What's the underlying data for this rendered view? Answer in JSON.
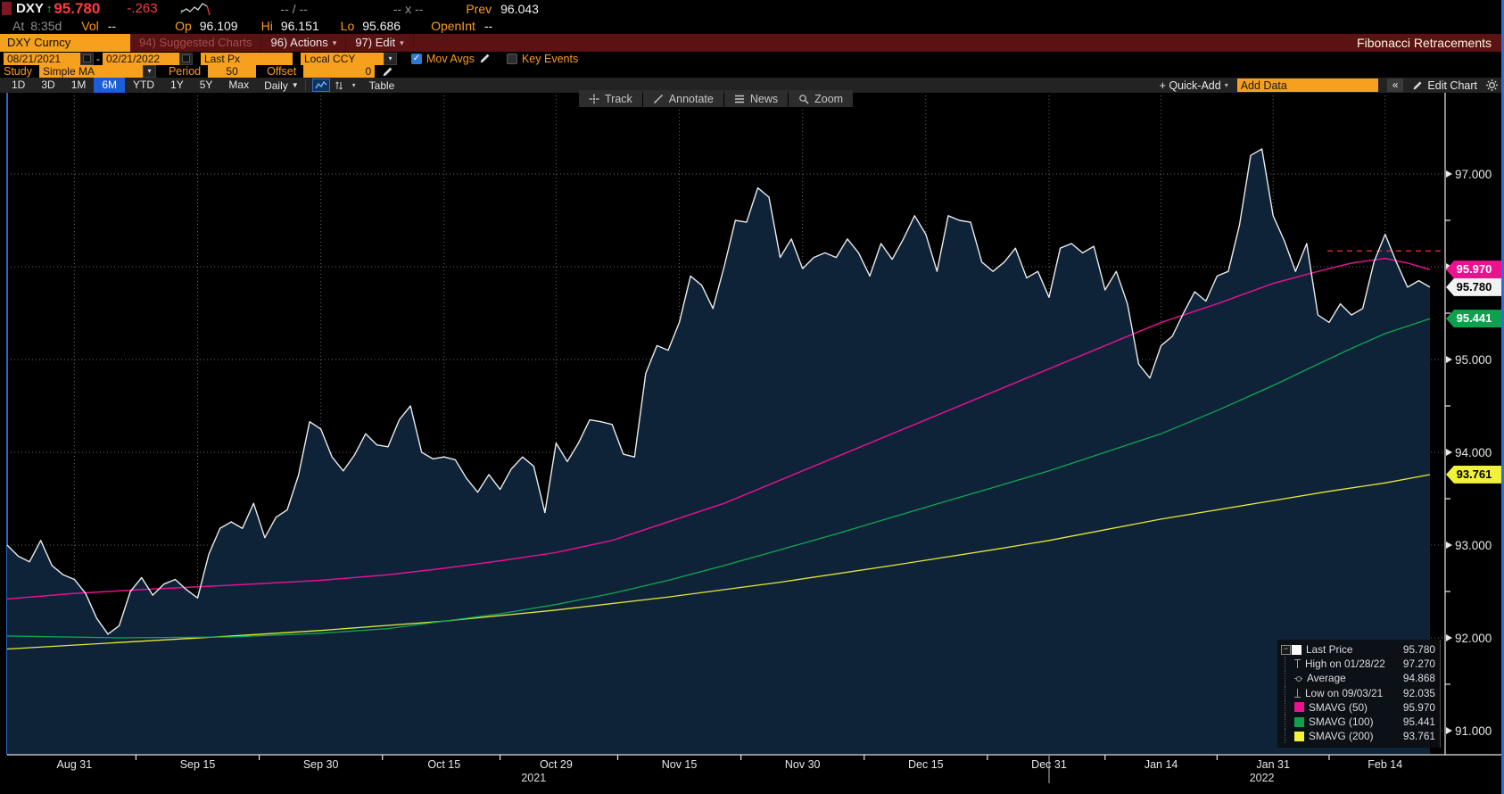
{
  "quote": {
    "symbol": "DXY",
    "direction_arrow": "↑",
    "price": "95.780",
    "change": "-.263",
    "bid_ask": "-- / --",
    "cross": "-- x --",
    "prev_label": "Prev",
    "prev_value": "96.043",
    "at_label": "At",
    "at_value": "8:35d",
    "vol_label": "Vol",
    "vol_value": "--",
    "op_label": "Op",
    "op_value": "96.109",
    "hi_label": "Hi",
    "hi_value": "96.151",
    "lo_label": "Lo",
    "lo_value": "95.686",
    "openint_label": "OpenInt",
    "openint_value": "--"
  },
  "security_bar": {
    "ticker": "DXY Curncy",
    "suggested_charts": "94) Suggested Charts",
    "actions": "96) Actions",
    "edit": "97) Edit",
    "title": "Fibonacci Retracements"
  },
  "settings_bar": {
    "date_from": "08/21/2021",
    "separator": "-",
    "date_to": "02/21/2022",
    "price_field": "Last Px",
    "currency": "Local CCY",
    "mov_avgs": "Mov Avgs",
    "mov_avgs_checked": "✓",
    "key_events": "Key Events"
  },
  "study_bar": {
    "study_label": "Study",
    "study_value": "Simple MA",
    "period_label": "Period",
    "period_value": "50",
    "offset_label": "Offset",
    "offset_value": "0"
  },
  "range_bar": {
    "ranges": [
      "1D",
      "3D",
      "1M",
      "6M",
      "YTD",
      "1Y",
      "5Y",
      "Max"
    ],
    "active": "6M",
    "frequency": "Daily",
    "table": "Table",
    "quick_add": "+ Quick-Add",
    "add_data": "Add Data",
    "collapse": "«",
    "edit_chart": "Edit Chart"
  },
  "chart_tools": {
    "track": "Track",
    "annotate": "Annotate",
    "news": "News",
    "zoom": "Zoom"
  },
  "legend": {
    "rows": [
      {
        "icon": "square",
        "color": "#ffffff",
        "label": "Last Price",
        "value": "95.780"
      },
      {
        "icon": "high",
        "color": "#9a9a9a",
        "label": "High on 01/28/22",
        "value": "97.270"
      },
      {
        "icon": "avg",
        "color": "#9a9a9a",
        "label": "Average",
        "value": "94.868"
      },
      {
        "icon": "low",
        "color": "#9a9a9a",
        "label": "Low on 09/03/21",
        "value": "92.035"
      },
      {
        "icon": "square",
        "color": "#ed1190",
        "label": "SMAVG (50)",
        "value": "95.970"
      },
      {
        "icon": "square",
        "color": "#0fa04e",
        "label": "SMAVG (100)",
        "value": "95.441"
      },
      {
        "icon": "square",
        "color": "#f2f23a",
        "label": "SMAVG (200)",
        "value": "93.761"
      }
    ]
  },
  "badges": [
    {
      "text": "95.970",
      "value": 95.97,
      "bg": "#ed1190",
      "fg": "#ffffff"
    },
    {
      "text": "95.780",
      "value": 95.78,
      "bg": "#f2f2f2",
      "fg": "#000000"
    },
    {
      "text": "95.441",
      "value": 95.441,
      "bg": "#0fa04e",
      "fg": "#ffffff"
    },
    {
      "text": "93.761",
      "value": 93.761,
      "bg": "#f2f23a",
      "fg": "#000000"
    }
  ],
  "chart_data": {
    "type": "line",
    "title": "DXY Curncy — Fibonacci Retracements, 6M Daily",
    "x_unit": "trading days from 08/23/2021",
    "x_range": [
      0,
      127
    ],
    "ylim": [
      90.95,
      97.9
    ],
    "y_ticks": [
      91,
      92,
      93,
      94,
      95,
      96,
      97
    ],
    "y_tick_format": "#.000",
    "y_minor_step": 0.5,
    "grid": "dotted",
    "legend_position": "bottom-right",
    "x_labels": [
      {
        "text": "Aug 31",
        "td": 6
      },
      {
        "text": "Sep 15",
        "td": 17
      },
      {
        "text": "Sep 30",
        "td": 28
      },
      {
        "text": "Oct 15",
        "td": 39
      },
      {
        "text": "Oct 29",
        "td": 49
      },
      {
        "text": "Nov 15",
        "td": 60
      },
      {
        "text": "Nov 30",
        "td": 71
      },
      {
        "text": "Dec 15",
        "td": 82
      },
      {
        "text": "Dec 31",
        "td": 93
      },
      {
        "text": "Jan 14",
        "td": 103
      },
      {
        "text": "Jan 31",
        "td": 113
      },
      {
        "text": "Feb 14",
        "td": 123
      }
    ],
    "year_labels": [
      {
        "text": "2021",
        "td": 47
      },
      {
        "text": "2022",
        "td": 112
      }
    ],
    "year_separator_td": 93,
    "annotations": [
      {
        "type": "dashed-segment",
        "value": 96.17,
        "color": "#c2282f"
      }
    ],
    "series": [
      {
        "name": "Last Price",
        "color": "#ebebeb",
        "fill": "#0e2338",
        "width": 1.4,
        "points": [
          [
            0,
            93.0
          ],
          [
            1,
            92.88
          ],
          [
            2,
            92.82
          ],
          [
            3,
            93.05
          ],
          [
            4,
            92.78
          ],
          [
            5,
            92.68
          ],
          [
            6,
            92.63
          ],
          [
            7,
            92.48
          ],
          [
            8,
            92.21
          ],
          [
            9,
            92.04
          ],
          [
            10,
            92.13
          ],
          [
            11,
            92.5
          ],
          [
            12,
            92.65
          ],
          [
            13,
            92.46
          ],
          [
            14,
            92.58
          ],
          [
            15,
            92.63
          ],
          [
            16,
            92.52
          ],
          [
            17,
            92.43
          ],
          [
            18,
            92.9
          ],
          [
            19,
            93.18
          ],
          [
            20,
            93.25
          ],
          [
            21,
            93.18
          ],
          [
            22,
            93.45
          ],
          [
            23,
            93.08
          ],
          [
            24,
            93.3
          ],
          [
            25,
            93.38
          ],
          [
            26,
            93.75
          ],
          [
            27,
            94.33
          ],
          [
            28,
            94.25
          ],
          [
            29,
            93.95
          ],
          [
            30,
            93.8
          ],
          [
            31,
            93.97
          ],
          [
            32,
            94.2
          ],
          [
            33,
            94.08
          ],
          [
            34,
            94.06
          ],
          [
            35,
            94.35
          ],
          [
            36,
            94.5
          ],
          [
            37,
            94.0
          ],
          [
            38,
            93.93
          ],
          [
            39,
            93.95
          ],
          [
            40,
            93.92
          ],
          [
            41,
            93.72
          ],
          [
            42,
            93.57
          ],
          [
            43,
            93.76
          ],
          [
            44,
            93.6
          ],
          [
            45,
            93.82
          ],
          [
            46,
            93.95
          ],
          [
            47,
            93.85
          ],
          [
            48,
            93.35
          ],
          [
            49,
            94.1
          ],
          [
            50,
            93.9
          ],
          [
            51,
            94.1
          ],
          [
            52,
            94.35
          ],
          [
            53,
            94.33
          ],
          [
            54,
            94.3
          ],
          [
            55,
            93.98
          ],
          [
            56,
            93.95
          ],
          [
            57,
            94.85
          ],
          [
            58,
            95.15
          ],
          [
            59,
            95.1
          ],
          [
            60,
            95.4
          ],
          [
            61,
            95.9
          ],
          [
            62,
            95.8
          ],
          [
            63,
            95.55
          ],
          [
            64,
            96.0
          ],
          [
            65,
            96.5
          ],
          [
            66,
            96.48
          ],
          [
            67,
            96.85
          ],
          [
            68,
            96.75
          ],
          [
            69,
            96.1
          ],
          [
            70,
            96.3
          ],
          [
            71,
            95.98
          ],
          [
            72,
            96.1
          ],
          [
            73,
            96.15
          ],
          [
            74,
            96.1
          ],
          [
            75,
            96.3
          ],
          [
            76,
            96.15
          ],
          [
            77,
            95.9
          ],
          [
            78,
            96.25
          ],
          [
            79,
            96.08
          ],
          [
            80,
            96.3
          ],
          [
            81,
            96.55
          ],
          [
            82,
            96.35
          ],
          [
            83,
            95.95
          ],
          [
            84,
            96.55
          ],
          [
            85,
            96.5
          ],
          [
            86,
            96.48
          ],
          [
            87,
            96.05
          ],
          [
            88,
            95.95
          ],
          [
            89,
            96.05
          ],
          [
            90,
            96.2
          ],
          [
            91,
            95.88
          ],
          [
            92,
            95.95
          ],
          [
            93,
            95.67
          ],
          [
            94,
            96.2
          ],
          [
            95,
            96.25
          ],
          [
            96,
            96.15
          ],
          [
            97,
            96.22
          ],
          [
            98,
            95.75
          ],
          [
            99,
            95.95
          ],
          [
            100,
            95.6
          ],
          [
            101,
            94.95
          ],
          [
            102,
            94.8
          ],
          [
            103,
            95.15
          ],
          [
            104,
            95.25
          ],
          [
            105,
            95.5
          ],
          [
            106,
            95.73
          ],
          [
            107,
            95.63
          ],
          [
            108,
            95.9
          ],
          [
            109,
            95.95
          ],
          [
            110,
            96.45
          ],
          [
            111,
            97.2
          ],
          [
            112,
            97.27
          ],
          [
            113,
            96.55
          ],
          [
            114,
            96.28
          ],
          [
            115,
            95.95
          ],
          [
            116,
            96.25
          ],
          [
            117,
            95.48
          ],
          [
            118,
            95.4
          ],
          [
            119,
            95.6
          ],
          [
            120,
            95.48
          ],
          [
            121,
            95.55
          ],
          [
            122,
            96.05
          ],
          [
            123,
            96.35
          ],
          [
            124,
            96.05
          ],
          [
            125,
            95.78
          ],
          [
            126,
            95.85
          ],
          [
            127,
            95.78
          ]
        ]
      },
      {
        "name": "SMAVG (50)",
        "color": "#e31191",
        "width": 1.5,
        "points": [
          [
            0,
            92.42
          ],
          [
            6,
            92.48
          ],
          [
            12,
            92.52
          ],
          [
            17,
            92.55
          ],
          [
            22,
            92.58
          ],
          [
            28,
            92.62
          ],
          [
            34,
            92.68
          ],
          [
            39,
            92.75
          ],
          [
            44,
            92.83
          ],
          [
            49,
            92.92
          ],
          [
            54,
            93.05
          ],
          [
            59,
            93.25
          ],
          [
            64,
            93.45
          ],
          [
            69,
            93.7
          ],
          [
            74,
            93.95
          ],
          [
            79,
            94.2
          ],
          [
            84,
            94.45
          ],
          [
            88,
            94.65
          ],
          [
            93,
            94.9
          ],
          [
            98,
            95.15
          ],
          [
            103,
            95.4
          ],
          [
            108,
            95.6
          ],
          [
            113,
            95.82
          ],
          [
            117,
            95.95
          ],
          [
            120,
            96.04
          ],
          [
            123,
            96.09
          ],
          [
            125,
            96.04
          ],
          [
            127,
            95.97
          ]
        ]
      },
      {
        "name": "SMAVG (100)",
        "color": "#10a653",
        "width": 1.3,
        "points": [
          [
            0,
            92.02
          ],
          [
            10,
            92.0
          ],
          [
            20,
            92.01
          ],
          [
            28,
            92.05
          ],
          [
            34,
            92.1
          ],
          [
            39,
            92.18
          ],
          [
            44,
            92.26
          ],
          [
            49,
            92.36
          ],
          [
            54,
            92.48
          ],
          [
            59,
            92.62
          ],
          [
            64,
            92.78
          ],
          [
            69,
            92.95
          ],
          [
            74,
            93.12
          ],
          [
            79,
            93.3
          ],
          [
            84,
            93.48
          ],
          [
            88,
            93.62
          ],
          [
            93,
            93.8
          ],
          [
            98,
            94.0
          ],
          [
            103,
            94.2
          ],
          [
            108,
            94.45
          ],
          [
            113,
            94.72
          ],
          [
            117,
            94.95
          ],
          [
            120,
            95.12
          ],
          [
            123,
            95.28
          ],
          [
            127,
            95.44
          ]
        ]
      },
      {
        "name": "SMAVG (200)",
        "color": "#e6e833",
        "width": 1.3,
        "points": [
          [
            0,
            91.88
          ],
          [
            10,
            91.95
          ],
          [
            20,
            92.02
          ],
          [
            28,
            92.08
          ],
          [
            39,
            92.18
          ],
          [
            49,
            92.3
          ],
          [
            59,
            92.44
          ],
          [
            69,
            92.6
          ],
          [
            79,
            92.78
          ],
          [
            88,
            92.95
          ],
          [
            93,
            93.05
          ],
          [
            103,
            93.28
          ],
          [
            113,
            93.48
          ],
          [
            118,
            93.58
          ],
          [
            123,
            93.67
          ],
          [
            127,
            93.76
          ]
        ]
      }
    ]
  }
}
